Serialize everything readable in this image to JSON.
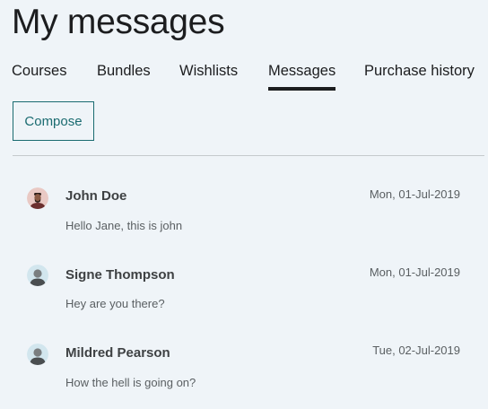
{
  "page": {
    "title": "My messages"
  },
  "tabs": [
    {
      "label": "Courses",
      "active": false
    },
    {
      "label": "Bundles",
      "active": false
    },
    {
      "label": "Wishlists",
      "active": false
    },
    {
      "label": "Messages",
      "active": true
    },
    {
      "label": "Purchase history",
      "active": false
    }
  ],
  "compose": {
    "label": "Compose"
  },
  "messages": [
    {
      "sender": "John Doe",
      "date": "Mon, 01-Jul-2019",
      "preview": "Hello Jane, this is john",
      "avatar": "avatar-john-doe"
    },
    {
      "sender": "Signe Thompson",
      "date": "Mon, 01-Jul-2019",
      "preview": "Hey are you there?",
      "avatar": "avatar-placeholder"
    },
    {
      "sender": "Mildred Pearson",
      "date": "Tue, 02-Jul-2019",
      "preview": "How the hell is going on?",
      "avatar": "avatar-placeholder"
    }
  ],
  "colors": {
    "accent": "#1a6b70",
    "background": "#eff4f8",
    "text": "#1c1d1f",
    "muted": "#5a5f62"
  }
}
